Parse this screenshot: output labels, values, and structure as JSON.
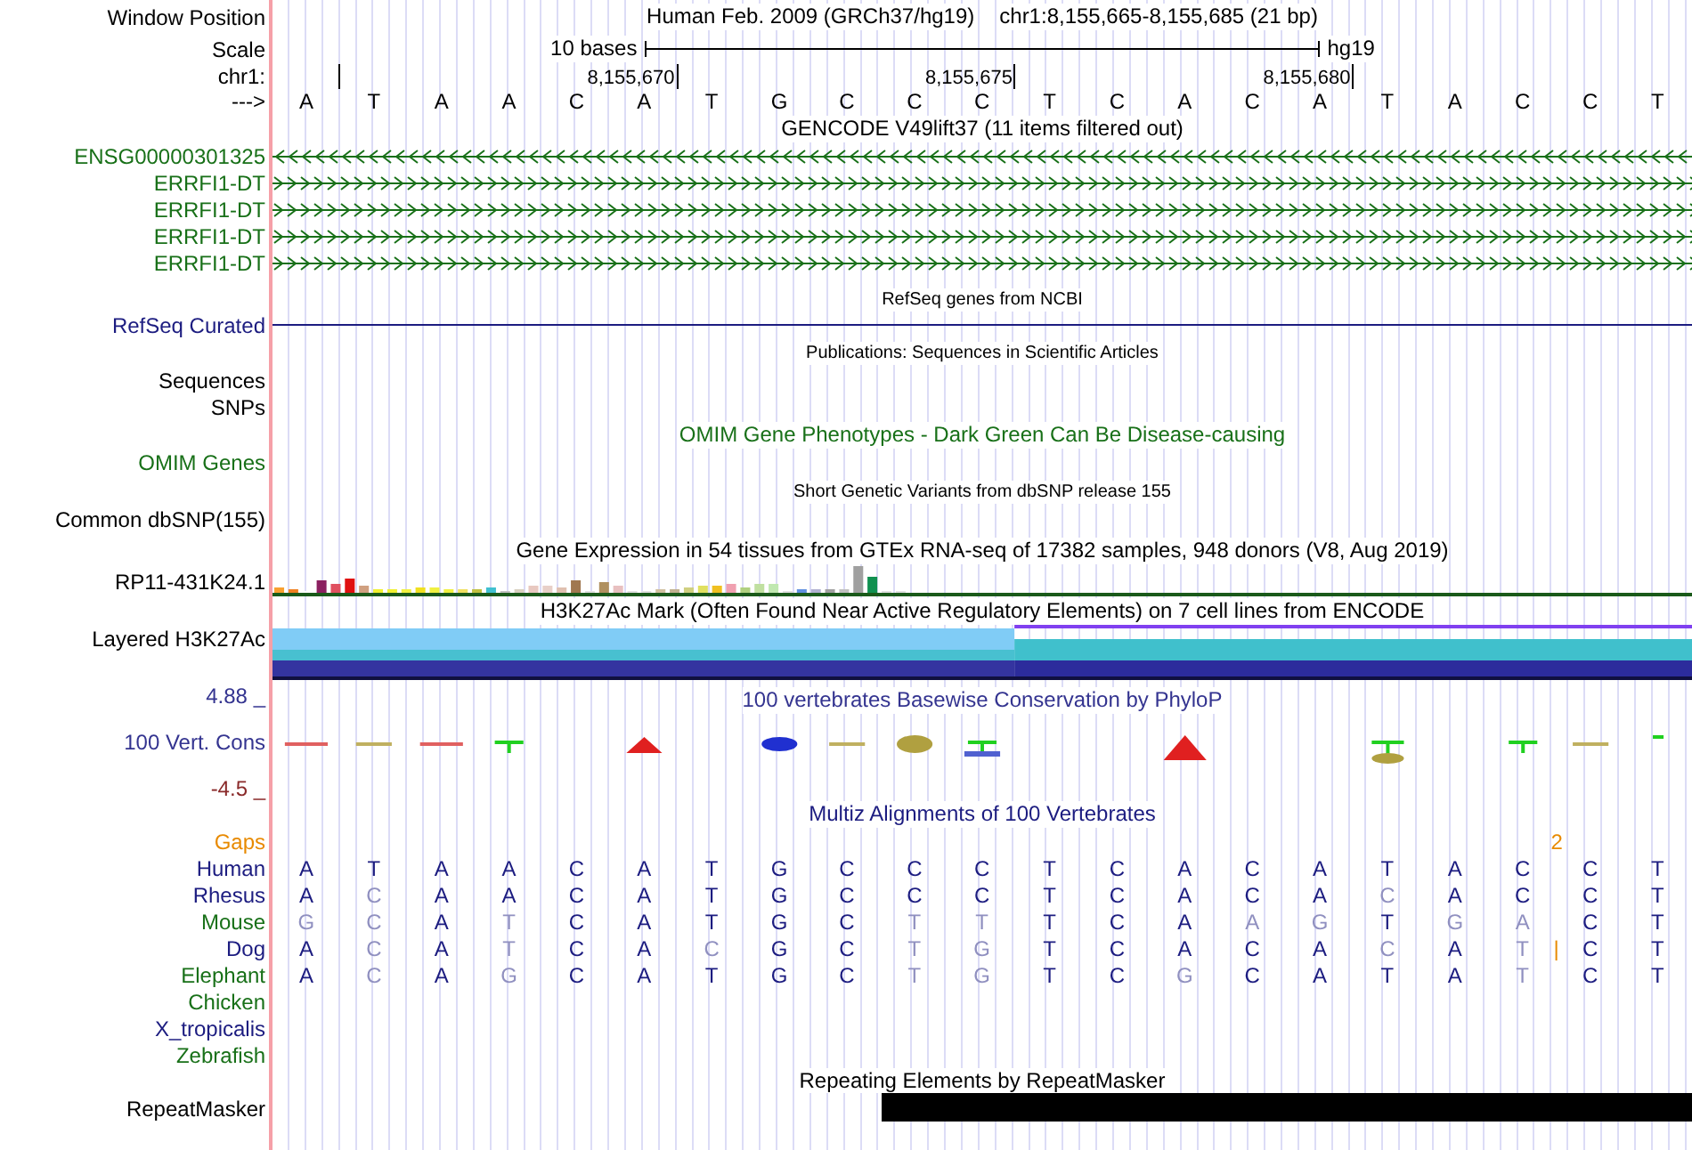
{
  "window_position": {
    "label": "Window Position",
    "assembly": "Human Feb. 2009 (GRCh37/hg19)",
    "region": "chr1:8,155,665-8,155,685 (21 bp)"
  },
  "scale": {
    "label": "Scale",
    "span": "10 bases",
    "assembly": "hg19"
  },
  "chromosome": {
    "label": "chr1:",
    "position_labels": [
      "8,155,670",
      "8,155,675",
      "8,155,680"
    ]
  },
  "sequence": {
    "label": "--->",
    "bases": [
      "A",
      "T",
      "A",
      "A",
      "C",
      "A",
      "T",
      "G",
      "C",
      "C",
      "C",
      "T",
      "C",
      "A",
      "C",
      "A",
      "T",
      "A",
      "C",
      "C",
      "T"
    ]
  },
  "gencode": {
    "title": "GENCODE V49lift37 (11 items filtered out)",
    "genes": [
      {
        "name": "ENSG00000301325",
        "color": "#187018",
        "reverse": true
      },
      {
        "name": "ERRFI1-DT",
        "color": "#187018",
        "reverse": false
      },
      {
        "name": "ERRFI1-DT",
        "color": "#187018",
        "reverse": false
      },
      {
        "name": "ERRFI1-DT",
        "color": "#187018",
        "reverse": false
      },
      {
        "name": "ERRFI1-DT",
        "color": "#187018",
        "reverse": false
      }
    ]
  },
  "refseq": {
    "title": "RefSeq genes from NCBI",
    "label": "RefSeq Curated"
  },
  "publications": {
    "title": "Publications: Sequences in Scientific Articles",
    "labels": [
      "Sequences",
      "SNPs"
    ]
  },
  "omim": {
    "title": "OMIM Gene Phenotypes - Dark Green Can Be Disease-causing",
    "label": "OMIM Genes"
  },
  "dbsnp": {
    "title": "Short Genetic Variants from dbSNP release 155",
    "label": "Common dbSNP(155)"
  },
  "gtex": {
    "title": "Gene Expression in 54 tissues from GTEx RNA-seq of 17382 samples, 948 donors (V8, Aug 2019)",
    "label": "RP11-431K24.1"
  },
  "h3k27ac": {
    "title": "H3K27Ac Mark (Often Found Near Active Regulatory Elements) on 7 cell lines from ENCODE",
    "label": "Layered H3K27Ac"
  },
  "conservation": {
    "title": "100 vertebrates Basewise Conservation by PhyloP",
    "max": "4.88 _",
    "label": "100 Vert. Cons",
    "min": "-4.5 _"
  },
  "multiz": {
    "title": "Multiz Alignments of 100 Vertebrates",
    "gaps": {
      "label": "Gaps",
      "count": "2"
    },
    "species": [
      {
        "name": "Human",
        "color": "#1c1c80",
        "bases": [
          {
            "b": "A",
            "match": true
          },
          {
            "b": "T",
            "match": true
          },
          {
            "b": "A",
            "match": true
          },
          {
            "b": "A",
            "match": true
          },
          {
            "b": "C",
            "match": true
          },
          {
            "b": "A",
            "match": true
          },
          {
            "b": "T",
            "match": true
          },
          {
            "b": "G",
            "match": true
          },
          {
            "b": "C",
            "match": true
          },
          {
            "b": "C",
            "match": true
          },
          {
            "b": "C",
            "match": true
          },
          {
            "b": "T",
            "match": true
          },
          {
            "b": "C",
            "match": true
          },
          {
            "b": "A",
            "match": true
          },
          {
            "b": "C",
            "match": true
          },
          {
            "b": "A",
            "match": true
          },
          {
            "b": "T",
            "match": true
          },
          {
            "b": "A",
            "match": true
          },
          {
            "b": "C",
            "match": true
          },
          {
            "b": "C",
            "match": true
          },
          {
            "b": "T",
            "match": true
          }
        ]
      },
      {
        "name": "Rhesus",
        "color": "#1c1c80",
        "bases": [
          {
            "b": "A",
            "match": true
          },
          {
            "b": "C",
            "match": false
          },
          {
            "b": "A",
            "match": true
          },
          {
            "b": "A",
            "match": true
          },
          {
            "b": "C",
            "match": true
          },
          {
            "b": "A",
            "match": true
          },
          {
            "b": "T",
            "match": true
          },
          {
            "b": "G",
            "match": true
          },
          {
            "b": "C",
            "match": true
          },
          {
            "b": "C",
            "match": true
          },
          {
            "b": "C",
            "match": true
          },
          {
            "b": "T",
            "match": true
          },
          {
            "b": "C",
            "match": true
          },
          {
            "b": "A",
            "match": true
          },
          {
            "b": "C",
            "match": true
          },
          {
            "b": "A",
            "match": true
          },
          {
            "b": "C",
            "match": false
          },
          {
            "b": "A",
            "match": true
          },
          {
            "b": "C",
            "match": true
          },
          {
            "b": "C",
            "match": true
          },
          {
            "b": "T",
            "match": true
          }
        ]
      },
      {
        "name": "Mouse",
        "color": "#187018",
        "bases": [
          {
            "b": "G",
            "match": false
          },
          {
            "b": "C",
            "match": false
          },
          {
            "b": "A",
            "match": true
          },
          {
            "b": "T",
            "match": false
          },
          {
            "b": "C",
            "match": true
          },
          {
            "b": "A",
            "match": true
          },
          {
            "b": "T",
            "match": true
          },
          {
            "b": "G",
            "match": true
          },
          {
            "b": "C",
            "match": true
          },
          {
            "b": "T",
            "match": false
          },
          {
            "b": "T",
            "match": false
          },
          {
            "b": "T",
            "match": true
          },
          {
            "b": "C",
            "match": true
          },
          {
            "b": "A",
            "match": true
          },
          {
            "b": "A",
            "match": false
          },
          {
            "b": "G",
            "match": false
          },
          {
            "b": "T",
            "match": true
          },
          {
            "b": "G",
            "match": false
          },
          {
            "b": "A",
            "match": false
          },
          {
            "b": "C",
            "match": true
          },
          {
            "b": "T",
            "match": true
          }
        ]
      },
      {
        "name": "Dog",
        "color": "#1c1c80",
        "bases": [
          {
            "kind": "base",
            "b": "A",
            "match": true
          },
          {
            "kind": "base",
            "b": "C",
            "match": false
          },
          {
            "kind": "base",
            "b": "A",
            "match": true
          },
          {
            "kind": "base",
            "b": "T",
            "match": false
          },
          {
            "kind": "base",
            "b": "C",
            "match": true
          },
          {
            "kind": "base",
            "b": "A",
            "match": true
          },
          {
            "kind": "base",
            "b": "C",
            "match": false
          },
          {
            "kind": "base",
            "b": "G",
            "match": true
          },
          {
            "kind": "base",
            "b": "C",
            "match": true
          },
          {
            "kind": "base",
            "b": "T",
            "match": false
          },
          {
            "kind": "base",
            "b": "G",
            "match": false
          },
          {
            "kind": "base",
            "b": "T",
            "match": true
          },
          {
            "kind": "base",
            "b": "C",
            "match": true
          },
          {
            "kind": "base",
            "b": "A",
            "match": true
          },
          {
            "kind": "base",
            "b": "C",
            "match": true
          },
          {
            "kind": "base",
            "b": "A",
            "match": true
          },
          {
            "kind": "base",
            "b": "C",
            "match": false
          },
          {
            "kind": "base",
            "b": "A",
            "match": true
          },
          {
            "kind": "base",
            "b": "T",
            "match": false
          },
          {
            "kind": "insert",
            "b": "|"
          },
          {
            "kind": "base",
            "b": "C",
            "match": true
          },
          {
            "kind": "base",
            "b": "T",
            "match": true
          }
        ]
      },
      {
        "name": "Elephant",
        "color": "#187018",
        "bases": [
          {
            "b": "A",
            "match": true
          },
          {
            "b": "C",
            "match": false
          },
          {
            "b": "A",
            "match": true
          },
          {
            "b": "G",
            "match": false
          },
          {
            "b": "C",
            "match": true
          },
          {
            "b": "A",
            "match": true
          },
          {
            "b": "T",
            "match": true
          },
          {
            "b": "G",
            "match": true
          },
          {
            "b": "C",
            "match": true
          },
          {
            "b": "T",
            "match": false
          },
          {
            "b": "G",
            "match": false
          },
          {
            "b": "T",
            "match": true
          },
          {
            "b": "C",
            "match": true
          },
          {
            "b": "G",
            "match": false
          },
          {
            "b": "C",
            "match": true
          },
          {
            "b": "A",
            "match": true
          },
          {
            "b": "T",
            "match": true
          },
          {
            "b": "A",
            "match": true
          },
          {
            "b": "T",
            "match": false
          },
          {
            "b": "C",
            "match": true
          },
          {
            "b": "T",
            "match": true
          }
        ]
      },
      {
        "name": "Chicken",
        "color": "#187018"
      },
      {
        "name": "X_tropicalis",
        "color": "#1c1c80"
      },
      {
        "name": "Zebrafish",
        "color": "#187018"
      }
    ]
  },
  "repeatmasker": {
    "title": "Repeating Elements by RepeatMasker",
    "label": "RepeatMasker"
  }
}
